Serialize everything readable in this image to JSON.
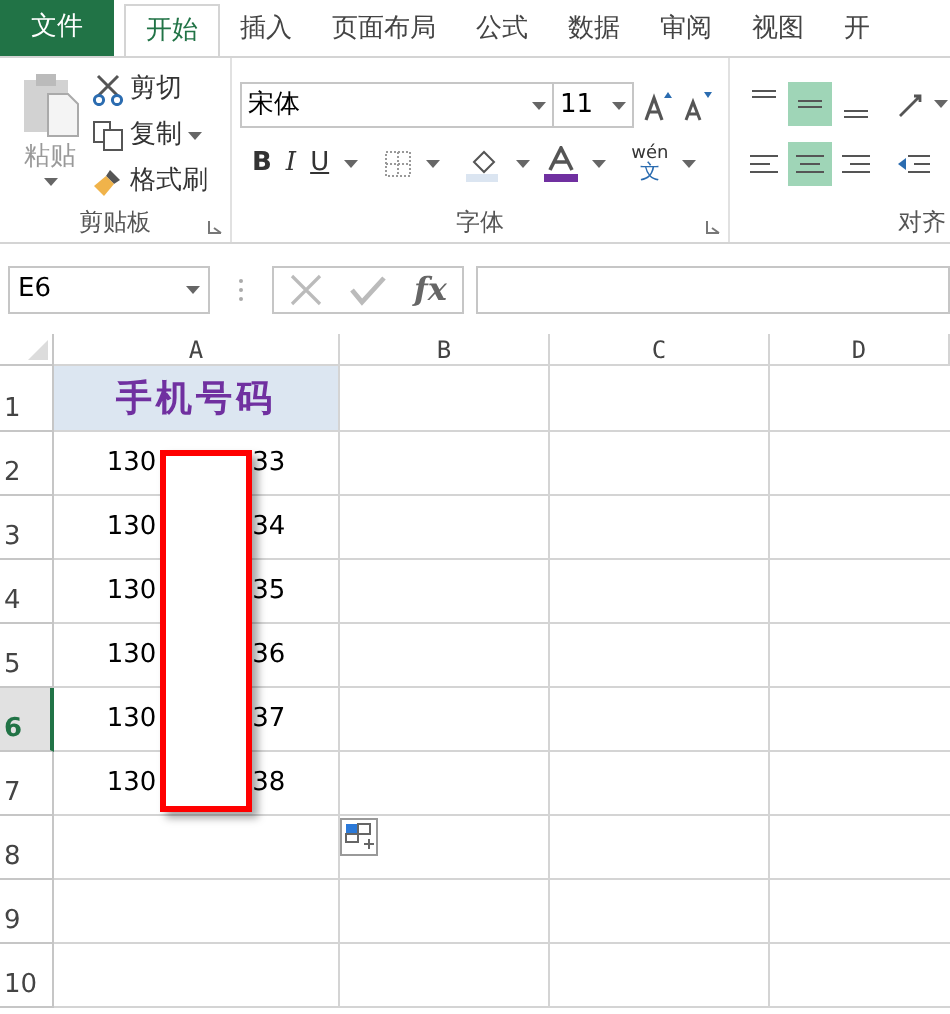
{
  "tabs": [
    {
      "label": "文件",
      "kind": "file",
      "selected": false
    },
    {
      "label": "开始",
      "kind": "tab",
      "selected": true
    },
    {
      "label": "插入",
      "kind": "tab",
      "selected": false
    },
    {
      "label": "页面布局",
      "kind": "tab",
      "selected": false
    },
    {
      "label": "公式",
      "kind": "tab",
      "selected": false
    },
    {
      "label": "数据",
      "kind": "tab",
      "selected": false
    },
    {
      "label": "审阅",
      "kind": "tab",
      "selected": false
    },
    {
      "label": "视图",
      "kind": "tab",
      "selected": false
    },
    {
      "label": "开",
      "kind": "tab",
      "selected": false
    }
  ],
  "clipboard": {
    "paste": "粘贴",
    "cut": "剪切",
    "copy": "复制",
    "format_painter": "格式刷",
    "label": "剪贴板"
  },
  "font": {
    "name": "宋体",
    "size": "11",
    "bold": "B",
    "italic": "I",
    "underline": "U",
    "phonetic_top": "wén",
    "phonetic_bottom": "文",
    "label": "字体"
  },
  "alignment": {
    "label": "对齐",
    "vertical": [
      {
        "selected": false
      },
      {
        "selected": true
      },
      {
        "selected": false
      }
    ],
    "horizontal": [
      {
        "selected": false
      },
      {
        "selected": true
      },
      {
        "selected": false
      }
    ]
  },
  "name_box": "E6",
  "function_label": "fx",
  "columns": [
    {
      "label": "A"
    },
    {
      "label": "B"
    },
    {
      "label": "C"
    },
    {
      "label": "D"
    }
  ],
  "header_cell": "手机号码",
  "redaction": {
    "shown": true
  },
  "rows": [
    {
      "number": "1",
      "selected": false,
      "kind": "header"
    },
    {
      "number": "2",
      "selected": false,
      "kind": "phone",
      "start": "130",
      "end": "33"
    },
    {
      "number": "3",
      "selected": false,
      "kind": "phone",
      "start": "130",
      "end": "34"
    },
    {
      "number": "4",
      "selected": false,
      "kind": "phone",
      "start": "130",
      "end": "35"
    },
    {
      "number": "5",
      "selected": false,
      "kind": "phone",
      "start": "130",
      "end": "36"
    },
    {
      "number": "6",
      "selected": true,
      "kind": "phone",
      "start": "130",
      "end": "37"
    },
    {
      "number": "7",
      "selected": false,
      "kind": "phone",
      "start": "130",
      "end": "38"
    },
    {
      "number": "8",
      "selected": false,
      "kind": "empty"
    },
    {
      "number": "9",
      "selected": false,
      "kind": "empty"
    },
    {
      "number": "10",
      "selected": false,
      "kind": "empty"
    }
  ]
}
